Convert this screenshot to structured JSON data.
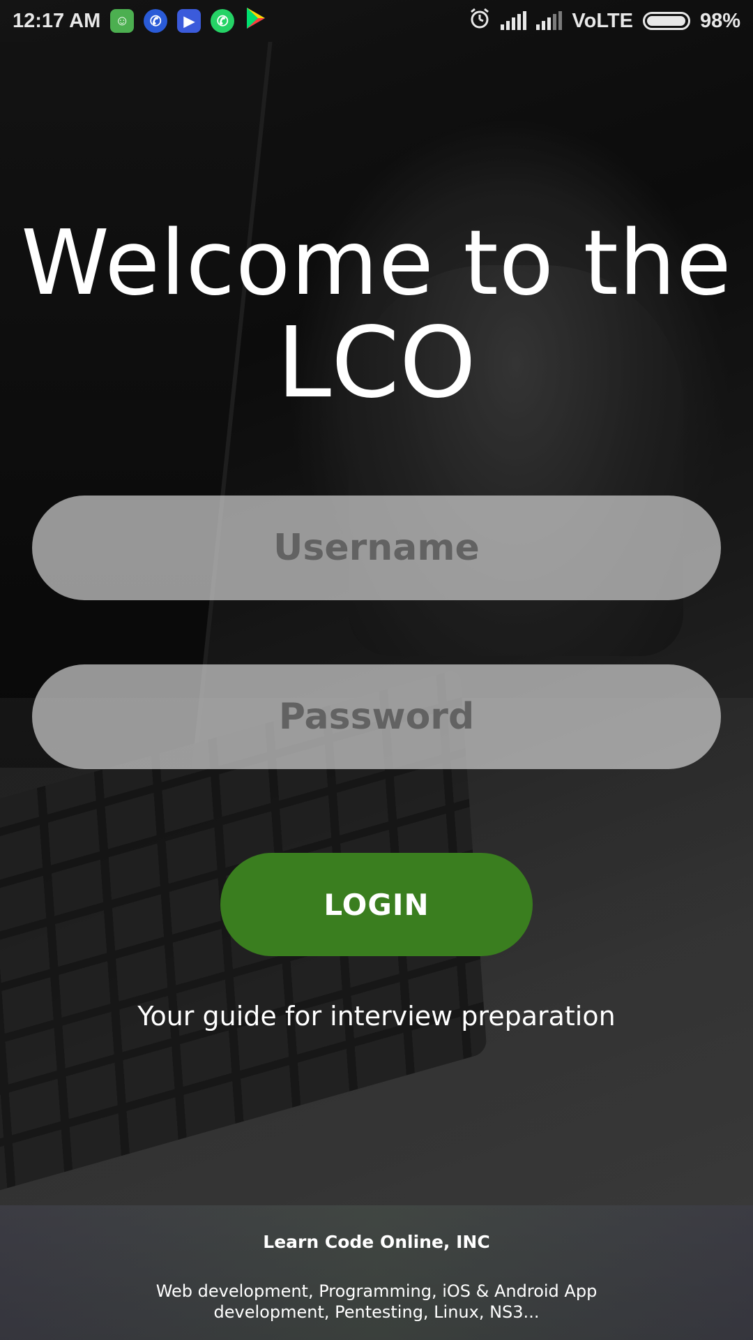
{
  "status_bar": {
    "time": "12:17 AM",
    "icons": [
      {
        "name": "android-icon",
        "color": "#4caf50"
      },
      {
        "name": "phone-call-icon",
        "color": "#2a5bd7"
      },
      {
        "name": "video-call-icon",
        "color": "#3b5bdb"
      },
      {
        "name": "whatsapp-icon",
        "color": "#25d366"
      },
      {
        "name": "play-store-icon",
        "color": "#00c4ff"
      }
    ],
    "network": "VoLTE",
    "battery": "98%",
    "battery_level": 0.98
  },
  "header": {
    "line1": "Welcome to the",
    "line2": "LCO"
  },
  "form": {
    "username_placeholder": "Username",
    "password_placeholder": "Password",
    "login_label": "LOGIN",
    "accent_color": "#3a7e1f"
  },
  "tagline": "Your guide for interview preparation",
  "footer": {
    "title": "Learn Code Online, INC",
    "description": "Web development, Programming, iOS & Android App development, Pentesting, Linux, NS3..."
  }
}
